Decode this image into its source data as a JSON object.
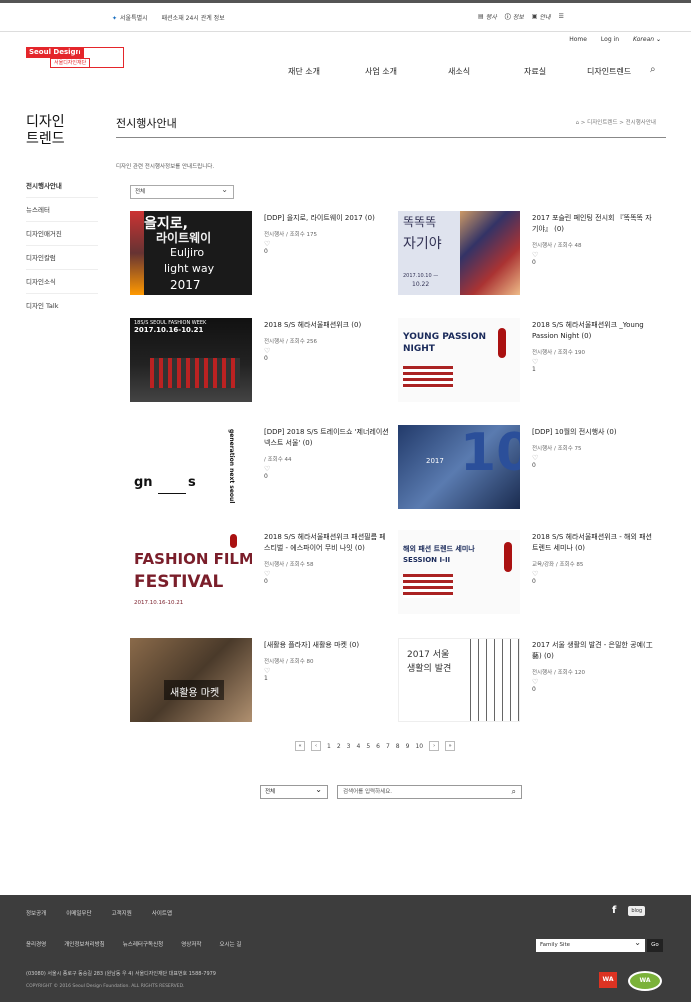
{
  "util_left": [
    "서울특별시",
    "패션소재 24시 관계 정보"
  ],
  "util_right": [
    "행사",
    "정보",
    "안내",
    "메뉴"
  ],
  "logo": {
    "en": "Seoul Design",
    "ko": "서울디자인재단"
  },
  "top_links": [
    "Home",
    "Log in",
    "Korean"
  ],
  "gnb": [
    "재단 소개",
    "사업 소개",
    "새소식",
    "자료실",
    "디자인트렌드"
  ],
  "lnb": {
    "title_line1": "디자인",
    "title_line2": "트렌드",
    "items": [
      "전시행사안내",
      "뉴스레터",
      "디자인매거진",
      "디자인칼럼",
      "디자인소식",
      "디자인 Talk"
    ]
  },
  "page": {
    "title": "전시행사안내",
    "breadcrumb": "⌂ > 디자인트렌드 > 전시행사안내",
    "desc": "디자인 관련 전시행사정보를 안내드립니다.",
    "filter": "전체"
  },
  "cards": [
    {
      "title": "[DDP] 을지로, 라이트웨이 2017 (0)",
      "meta": "전시행사 / 조회수 175",
      "likes": "0",
      "poster": {
        "lines": [
          "을지로,",
          "라이트웨이",
          "Euljiro",
          "light way",
          "2017"
        ]
      }
    },
    {
      "title": "2017 포슬린 페인팅 전시회 『똑똑똑 자기야』 (0)",
      "meta": "전시행사 / 조회수 48",
      "likes": "0",
      "poster": {
        "lines": [
          "똑똑똑",
          "자기야",
          "2017.10.10 —",
          "10.22"
        ]
      }
    },
    {
      "title": "2018 S/S 헤라서울패션위크 (0)",
      "meta": "전시행사 / 조회수 256",
      "likes": "0",
      "poster": {
        "lines": [
          "18S/S SEOUL FASHION WEEK",
          "2017.10.16-10.21"
        ]
      }
    },
    {
      "title": "2018 S/S 헤라서울패션위크 _Young Passion Night (0)",
      "meta": "전시행사 / 조회수 190",
      "likes": "1",
      "poster": {
        "lines": [
          "YOUNG PASSION",
          "NIGHT"
        ]
      }
    },
    {
      "title": "[DDP] 2018 S/S 트레이드쇼 '제너레이션 넥스트 서울' (0)",
      "meta": "/ 조회수 44",
      "likes": "0",
      "poster": {
        "lines": [
          "gn",
          "s",
          "generation next seoul"
        ]
      }
    },
    {
      "title": "[DDP] 10월의 전시행사 (0)",
      "meta": "전시행사 / 조회수 75",
      "likes": "0",
      "poster": {
        "lines": [
          "10",
          "2017"
        ]
      }
    },
    {
      "title": "2018 S/S 헤라서울패션위크 패션필름 페스티벌 - 에스파이어 무비 나잇 (0)",
      "meta": "전시행사 / 조회수 58",
      "likes": "0",
      "poster": {
        "lines": [
          "FASHION FILM",
          "FESTIVAL",
          "2017.10.16-10.21"
        ]
      }
    },
    {
      "title": "2018 S/S 헤라서울패션위크 - 해외 패션 트렌드 세미나 (0)",
      "meta": "교육/강좌 / 조회수 85",
      "likes": "0",
      "poster": {
        "lines": [
          "해외 패션 트렌드 세미나",
          "SESSION I-II"
        ]
      }
    },
    {
      "title": "[새활용 플라자] 새활용 마켓 (0)",
      "meta": "전시행사 / 조회수 80",
      "likes": "1",
      "poster": {
        "lines": [
          "새활용 마켓"
        ]
      }
    },
    {
      "title": "2017 서울 생활의 발견 - 은밀한 공예(工藝) (0)",
      "meta": "전시행사 / 조회수 120",
      "likes": "0",
      "poster": {
        "lines": [
          "2017 서울",
          "생활의 발견"
        ]
      }
    }
  ],
  "pager": [
    "«",
    "‹",
    "1",
    "2",
    "3",
    "4",
    "5",
    "6",
    "7",
    "8",
    "9",
    "10",
    "›",
    "»"
  ],
  "search": {
    "scope": "전체",
    "placeholder": "검색어를 입력하세요."
  },
  "footer": {
    "links1": [
      "정보공개",
      "이메일무단",
      "고객지원",
      "사이트맵"
    ],
    "links2": [
      "윤리경영",
      "개인정보처리방침",
      "뉴스레터구독신청",
      "영상저작",
      "오시는 길"
    ],
    "family_site": "Family Site",
    "go": "Go",
    "address": "(03080) 서울시 종로구 동숭길 283 (원남동 우 4) 서울디자인재단 대표번호 1588-7979",
    "copyright": "COPYRIGHT © 2016 Seoul Design Foundation. ALL RIGHTS RESERVED.",
    "sns": [
      "f",
      "blog"
    ],
    "badges": [
      "WA",
      "WA"
    ]
  }
}
